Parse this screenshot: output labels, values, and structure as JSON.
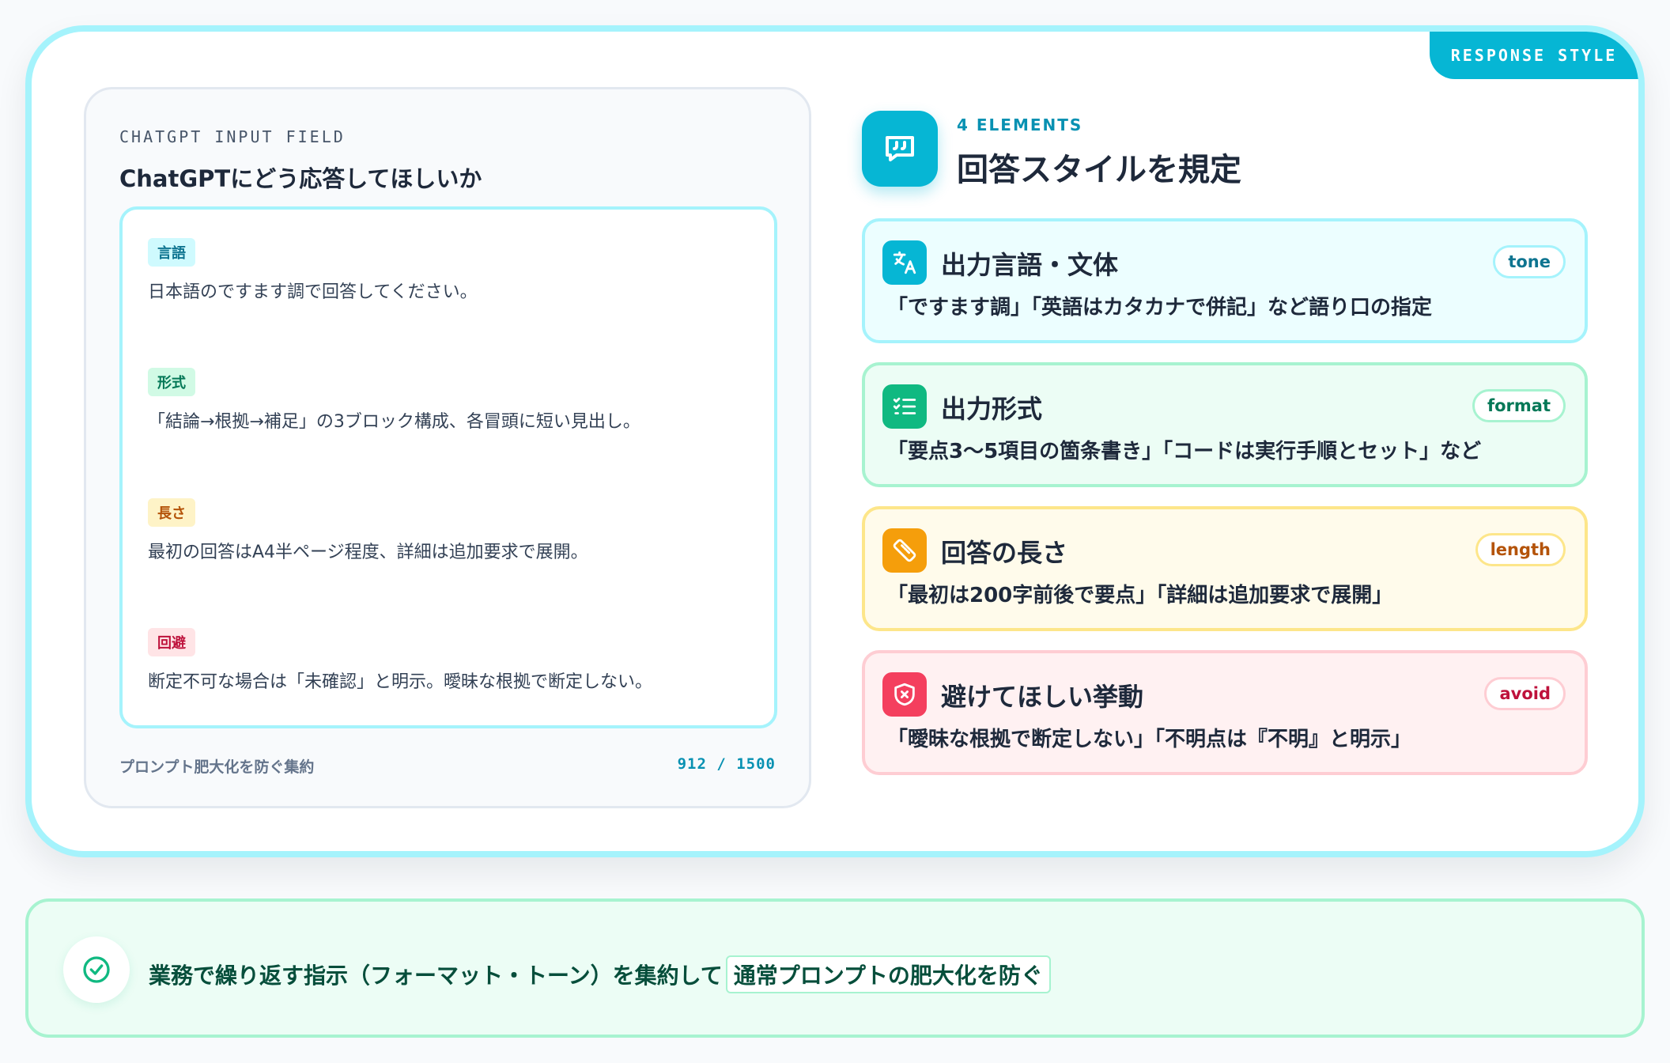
{
  "ribbon": "RESPONSE STYLE",
  "input_panel": {
    "kicker": "CHATGPT INPUT FIELD",
    "title": "ChatGPTにどう応答してほしいか",
    "fields": [
      {
        "tag": "言語",
        "text": "日本語のですます調で回答してください。"
      },
      {
        "tag": "形式",
        "text": "「結論→根拠→補足」の3ブロック構成、各冒頭に短い見出し。"
      },
      {
        "tag": "長さ",
        "text": "最初の回答はA4半ページ程度、詳細は追加要求で展開。"
      },
      {
        "tag": "回避",
        "text": "断定不可な場合は「未確認」と明示。曖昧な根拠で断定しない。"
      }
    ],
    "footer_label": "プロンプト肥大化を防ぐ集約",
    "char_count": "912 / 1500"
  },
  "header": {
    "kicker": "4 ELEMENTS",
    "title": "回答スタイルを規定",
    "icon": "quote-bubble-icon"
  },
  "elements": [
    {
      "title": "出力言語・文体",
      "badge": "tone",
      "desc": "「ですます調」「英語はカタカナで併記」など語り口の指定",
      "icon": "translate-icon",
      "color": "#06b6d4"
    },
    {
      "title": "出力形式",
      "badge": "format",
      "desc": "「要点3〜5項目の箇条書き」「コードは実行手順とセット」など",
      "icon": "checklist-icon",
      "color": "#10b981"
    },
    {
      "title": "回答の長さ",
      "badge": "length",
      "desc": "「最初は200字前後で要点」「詳細は追加要求で展開」",
      "icon": "ruler-icon",
      "color": "#f59e0b"
    },
    {
      "title": "避けてほしい挙動",
      "badge": "avoid",
      "desc": "「曖昧な根拠で断定しない」「不明点は『不明』と明示」",
      "icon": "shield-x-icon",
      "color": "#f43f5e"
    }
  ],
  "bottom": {
    "text": "業務で繰り返す指示（フォーマット・トーン）を集約して",
    "highlight": "通常プロンプトの肥大化を防ぐ",
    "icon": "check-circle-icon"
  }
}
